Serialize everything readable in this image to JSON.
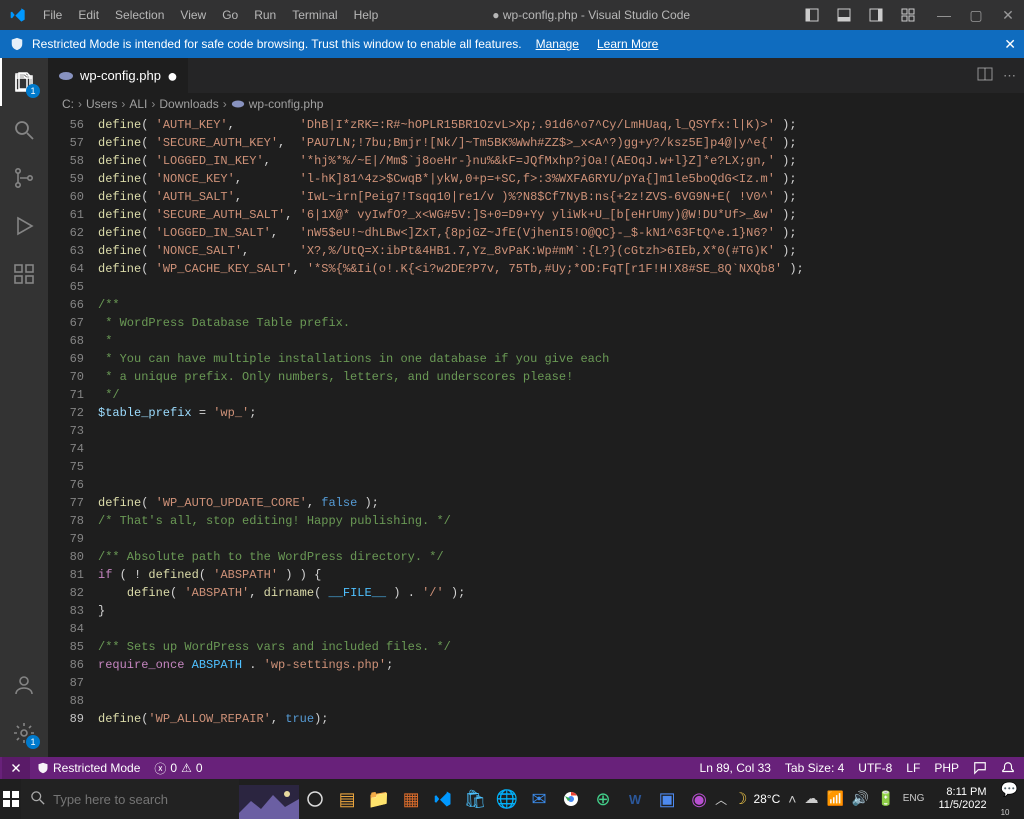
{
  "titlebar": {
    "menu": [
      "File",
      "Edit",
      "Selection",
      "View",
      "Go",
      "Run",
      "Terminal",
      "Help"
    ],
    "title": "● wp-config.php - Visual Studio Code"
  },
  "banner": {
    "text": "Restricted Mode is intended for safe code browsing. Trust this window to enable all features.",
    "manage": "Manage",
    "learn_more": "Learn More"
  },
  "activitybar": {
    "explorer_badge": "1",
    "manage_badge": "1"
  },
  "tab": {
    "filename": "wp-config.php"
  },
  "breadcrumbs": {
    "parts": [
      "C:",
      "Users",
      "ALI",
      "Downloads",
      "wp-config.php"
    ]
  },
  "editor": {
    "first_line_number": 56,
    "current_line": 89,
    "lines": [
      {
        "n": 56,
        "segs": [
          {
            "c": "fn",
            "t": "define"
          },
          {
            "c": "punct",
            "t": "( "
          },
          {
            "c": "str",
            "t": "'AUTH_KEY'"
          },
          {
            "c": "punct",
            "t": ",         "
          },
          {
            "c": "str",
            "t": "'DhB|I*zRK=:R#~hOPLR15BR1OzvL>Xp;.91d6^o7^Cy/LmHUaq,l_QSYfx:l|K)>'"
          },
          {
            "c": "punct",
            "t": " );"
          }
        ]
      },
      {
        "n": 57,
        "segs": [
          {
            "c": "fn",
            "t": "define"
          },
          {
            "c": "punct",
            "t": "( "
          },
          {
            "c": "str",
            "t": "'SECURE_AUTH_KEY'"
          },
          {
            "c": "punct",
            "t": ",  "
          },
          {
            "c": "str",
            "t": "'PAU7LN;!7bu;Bmjr![Nk/]~Tm5BK%Wwh#ZZ$>_x<A^?)gg+y?/ksz5E]p4@|y^e{'"
          },
          {
            "c": "punct",
            "t": " );"
          }
        ]
      },
      {
        "n": 58,
        "segs": [
          {
            "c": "fn",
            "t": "define"
          },
          {
            "c": "punct",
            "t": "( "
          },
          {
            "c": "str",
            "t": "'LOGGED_IN_KEY'"
          },
          {
            "c": "punct",
            "t": ",    "
          },
          {
            "c": "str",
            "t": "'*hj%*%/~E|/Mm$`j8oeHr-}nu%&kF=JQfMxhp?jOa!(AEOqJ.w+l}Z]*e?LX;gn,'"
          },
          {
            "c": "punct",
            "t": " );"
          }
        ]
      },
      {
        "n": 59,
        "segs": [
          {
            "c": "fn",
            "t": "define"
          },
          {
            "c": "punct",
            "t": "( "
          },
          {
            "c": "str",
            "t": "'NONCE_KEY'"
          },
          {
            "c": "punct",
            "t": ",        "
          },
          {
            "c": "str",
            "t": "'l-hK]81^4z>$CwqB*|ykW,0+p=+SC,f>:3%WXFA6RYU/pYa{]m1le5boQdG<Iz.m'"
          },
          {
            "c": "punct",
            "t": " );"
          }
        ]
      },
      {
        "n": 60,
        "segs": [
          {
            "c": "fn",
            "t": "define"
          },
          {
            "c": "punct",
            "t": "( "
          },
          {
            "c": "str",
            "t": "'AUTH_SALT'"
          },
          {
            "c": "punct",
            "t": ",        "
          },
          {
            "c": "str",
            "t": "'IwL~irn[Peig7!Tsqq10|re1/v )%?N8$Cf7NyB:ns{+2z!ZVS-6VG9N+E( !V0^'"
          },
          {
            "c": "punct",
            "t": " );"
          }
        ]
      },
      {
        "n": 61,
        "segs": [
          {
            "c": "fn",
            "t": "define"
          },
          {
            "c": "punct",
            "t": "( "
          },
          {
            "c": "str",
            "t": "'SECURE_AUTH_SALT'"
          },
          {
            "c": "punct",
            "t": ", "
          },
          {
            "c": "str",
            "t": "'6|1X@* vyIwfO?_x<WG#5V:]S+0=D9+Yy yliWk+U_[b[eHrUmy)@W!DU*Uf>_&w'"
          },
          {
            "c": "punct",
            "t": " );"
          }
        ]
      },
      {
        "n": 62,
        "segs": [
          {
            "c": "fn",
            "t": "define"
          },
          {
            "c": "punct",
            "t": "( "
          },
          {
            "c": "str",
            "t": "'LOGGED_IN_SALT'"
          },
          {
            "c": "punct",
            "t": ",   "
          },
          {
            "c": "str",
            "t": "'nW5$eU!~dhLBw<]ZxT,{8pjGZ~JfE(VjhenI5!O@QC}-_$-kN1^63FtQ^e.1}N6?'"
          },
          {
            "c": "punct",
            "t": " );"
          }
        ]
      },
      {
        "n": 63,
        "segs": [
          {
            "c": "fn",
            "t": "define"
          },
          {
            "c": "punct",
            "t": "( "
          },
          {
            "c": "str",
            "t": "'NONCE_SALT'"
          },
          {
            "c": "punct",
            "t": ",       "
          },
          {
            "c": "str",
            "t": "'X?,%/UtQ=X:ibPt&4HB1.7,Yz_8vPaK:Wp#mM`:{L?}(cGtzh>6IEb,X*0(#TG)K'"
          },
          {
            "c": "punct",
            "t": " );"
          }
        ]
      },
      {
        "n": 64,
        "segs": [
          {
            "c": "fn",
            "t": "define"
          },
          {
            "c": "punct",
            "t": "( "
          },
          {
            "c": "str",
            "t": "'WP_CACHE_KEY_SALT'"
          },
          {
            "c": "punct",
            "t": ", "
          },
          {
            "c": "str",
            "t": "'*S%{%&Ii(o!.K{<i?w2DE?P7v, 75Tb,#Uy;*OD:FqT[r1F!H!X8#SE_8Q`NXQb8'"
          },
          {
            "c": "punct",
            "t": " );"
          }
        ]
      },
      {
        "n": 65,
        "segs": []
      },
      {
        "n": 66,
        "segs": [
          {
            "c": "cmt",
            "t": "/**"
          }
        ]
      },
      {
        "n": 67,
        "segs": [
          {
            "c": "cmt",
            "t": " * WordPress Database Table prefix."
          }
        ]
      },
      {
        "n": 68,
        "segs": [
          {
            "c": "cmt",
            "t": " *"
          }
        ]
      },
      {
        "n": 69,
        "segs": [
          {
            "c": "cmt",
            "t": " * You can have multiple installations in one database if you give each"
          }
        ]
      },
      {
        "n": 70,
        "segs": [
          {
            "c": "cmt",
            "t": " * a unique prefix. Only numbers, letters, and underscores please!"
          }
        ]
      },
      {
        "n": 71,
        "segs": [
          {
            "c": "cmt",
            "t": " */"
          }
        ]
      },
      {
        "n": 72,
        "segs": [
          {
            "c": "var",
            "t": "$table_prefix"
          },
          {
            "c": "punct",
            "t": " = "
          },
          {
            "c": "str",
            "t": "'wp_'"
          },
          {
            "c": "punct",
            "t": ";"
          }
        ]
      },
      {
        "n": 73,
        "segs": []
      },
      {
        "n": 74,
        "segs": []
      },
      {
        "n": 75,
        "segs": []
      },
      {
        "n": 76,
        "segs": []
      },
      {
        "n": 77,
        "segs": [
          {
            "c": "fn",
            "t": "define"
          },
          {
            "c": "punct",
            "t": "( "
          },
          {
            "c": "str",
            "t": "'WP_AUTO_UPDATE_CORE'"
          },
          {
            "c": "punct",
            "t": ", "
          },
          {
            "c": "bool",
            "t": "false"
          },
          {
            "c": "punct",
            "t": " );"
          }
        ]
      },
      {
        "n": 78,
        "segs": [
          {
            "c": "cmt",
            "t": "/* That's all, stop editing! Happy publishing. */"
          }
        ]
      },
      {
        "n": 79,
        "segs": []
      },
      {
        "n": 80,
        "segs": [
          {
            "c": "cmt",
            "t": "/** Absolute path to the WordPress directory. */"
          }
        ]
      },
      {
        "n": 81,
        "segs": [
          {
            "c": "kw",
            "t": "if"
          },
          {
            "c": "punct",
            "t": " ( ! "
          },
          {
            "c": "fn",
            "t": "defined"
          },
          {
            "c": "punct",
            "t": "( "
          },
          {
            "c": "str",
            "t": "'ABSPATH'"
          },
          {
            "c": "punct",
            "t": " ) ) {"
          }
        ]
      },
      {
        "n": 82,
        "segs": [
          {
            "c": "punct",
            "t": "    "
          },
          {
            "c": "fn",
            "t": "define"
          },
          {
            "c": "punct",
            "t": "( "
          },
          {
            "c": "str",
            "t": "'ABSPATH'"
          },
          {
            "c": "punct",
            "t": ", "
          },
          {
            "c": "fn",
            "t": "dirname"
          },
          {
            "c": "punct",
            "t": "( "
          },
          {
            "c": "const",
            "t": "__FILE__"
          },
          {
            "c": "punct",
            "t": " ) . "
          },
          {
            "c": "str",
            "t": "'/'"
          },
          {
            "c": "punct",
            "t": " );"
          }
        ]
      },
      {
        "n": 83,
        "segs": [
          {
            "c": "punct",
            "t": "}"
          }
        ]
      },
      {
        "n": 84,
        "segs": []
      },
      {
        "n": 85,
        "segs": [
          {
            "c": "cmt",
            "t": "/** Sets up WordPress vars and included files. */"
          }
        ]
      },
      {
        "n": 86,
        "segs": [
          {
            "c": "kw",
            "t": "require_once"
          },
          {
            "c": "punct",
            "t": " "
          },
          {
            "c": "const",
            "t": "ABSPATH"
          },
          {
            "c": "punct",
            "t": " . "
          },
          {
            "c": "str",
            "t": "'wp-settings.php'"
          },
          {
            "c": "punct",
            "t": ";"
          }
        ]
      },
      {
        "n": 87,
        "segs": []
      },
      {
        "n": 88,
        "segs": []
      },
      {
        "n": 89,
        "segs": [
          {
            "c": "fn",
            "t": "define"
          },
          {
            "c": "punct",
            "t": "("
          },
          {
            "c": "str",
            "t": "'WP_ALLOW_REPAIR'"
          },
          {
            "c": "punct",
            "t": ", "
          },
          {
            "c": "bool",
            "t": "true"
          },
          {
            "c": "punct",
            "t": ");"
          }
        ]
      }
    ]
  },
  "statusbar": {
    "restricted": "Restricted Mode",
    "errors": "0",
    "warnings": "0",
    "ln_col": "Ln 89, Col 33",
    "tab_size": "Tab Size: 4",
    "encoding": "UTF-8",
    "eol": "LF",
    "language": "PHP"
  },
  "taskbar": {
    "search_placeholder": "Type here to search",
    "weather": "28°C",
    "time": "8:11 PM",
    "date": "11/5/2022",
    "notif_count": "10"
  }
}
